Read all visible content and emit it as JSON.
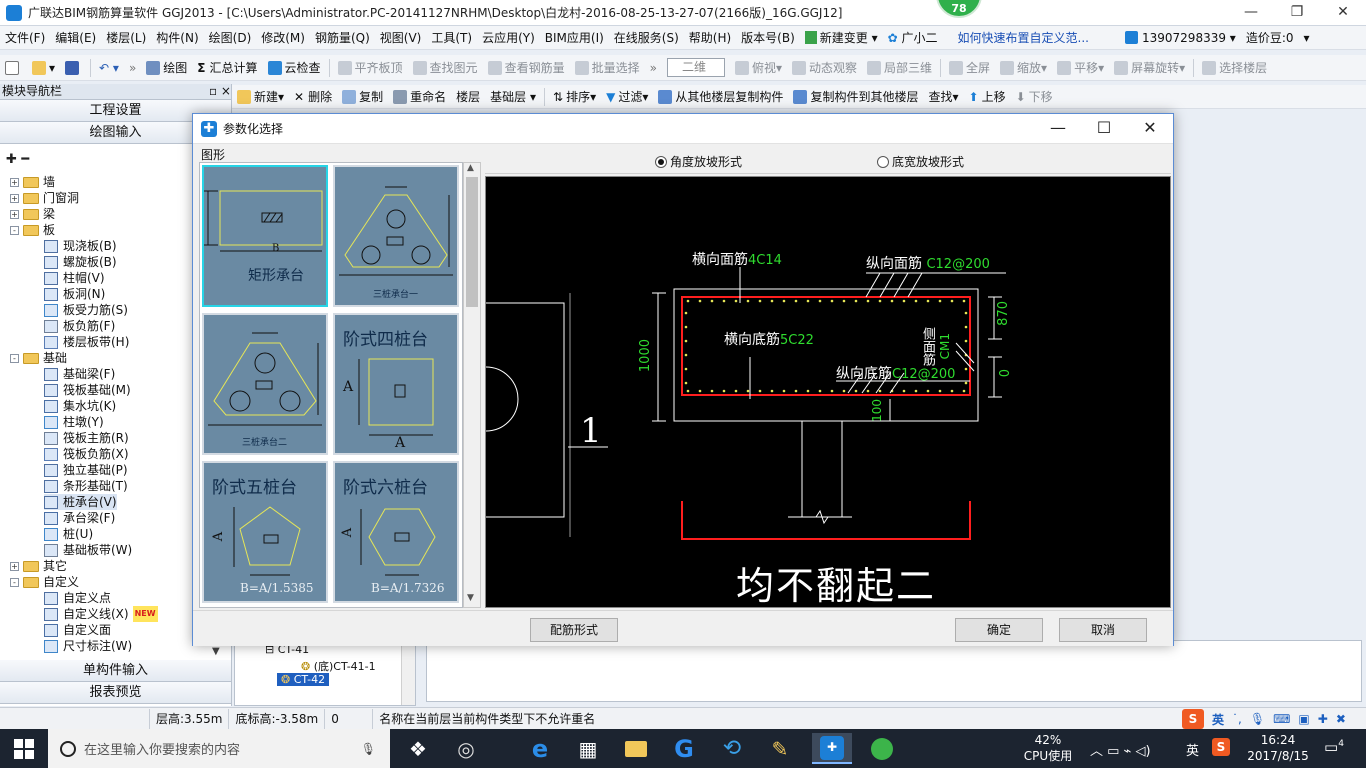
{
  "titlebar": {
    "title": "广联达BIM钢筋算量软件 GGJ2013 - [C:\\Users\\Administrator.PC-20141127NRHM\\Desktop\\白龙村-2016-08-25-13-27-07(2166版)_16G.GGJ12]",
    "badge": "78"
  },
  "menu": [
    "文件(F)",
    "编辑(E)",
    "楼层(L)",
    "构件(N)",
    "绘图(D)",
    "修改(M)",
    "钢筋量(Q)",
    "视图(V)",
    "工具(T)",
    "云应用(Y)",
    "BIM应用(I)",
    "在线服务(S)",
    "帮助(H)",
    "版本号(B)",
    "新建变更",
    "广小二",
    "如何快速布置自定义范...",
    "13907298339",
    "造价豆:0"
  ],
  "toolbar1": {
    "draw": "绘图",
    "sum": "汇总计算",
    "cloudcheck": "云检查",
    "flatten": "平齐板顶",
    "findelem": "查找图元",
    "viewrebar": "查看钢筋量",
    "batchsel": "批量选择",
    "view_mode": "二维",
    "topview": "俯视",
    "dynobserve": "动态观察",
    "local3d": "局部三维",
    "fullscreen": "全屏",
    "zoom": "缩放",
    "pan": "平移",
    "rotate": "屏幕旋转",
    "selfloor": "选择楼层"
  },
  "toolbar2": {
    "new": "新建",
    "delete": "删除",
    "copy": "复制",
    "rename": "重命名",
    "floor_label": "楼层",
    "floor_value": "基础层",
    "sort": "排序",
    "filter": "过滤",
    "copy_from": "从其他楼层复制构件",
    "copy_to": "复制构件到其他楼层",
    "find": "查找",
    "moveup": "上移",
    "movedown": "下移"
  },
  "leftpanel": {
    "header": "模块导航栏",
    "pin": "▫ ×",
    "btn_project": "工程设置",
    "btn_draw": "绘图输入",
    "btn_single": "单构件输入",
    "btn_report": "报表预览",
    "tree": [
      {
        "label": "墙",
        "level": 0,
        "toggle": "+",
        "folder": true
      },
      {
        "label": "门窗洞",
        "level": 0,
        "toggle": "+",
        "folder": true
      },
      {
        "label": "梁",
        "level": 0,
        "toggle": "+",
        "folder": true
      },
      {
        "label": "板",
        "level": 0,
        "toggle": "-",
        "folder": true
      },
      {
        "label": "现浇板(B)",
        "level": 1
      },
      {
        "label": "螺旋板(B)",
        "level": 1
      },
      {
        "label": "柱帽(V)",
        "level": 1
      },
      {
        "label": "板洞(N)",
        "level": 1
      },
      {
        "label": "板受力筋(S)",
        "level": 1
      },
      {
        "label": "板负筋(F)",
        "level": 1
      },
      {
        "label": "楼层板带(H)",
        "level": 1
      },
      {
        "label": "基础",
        "level": 0,
        "toggle": "-",
        "folder": true
      },
      {
        "label": "基础梁(F)",
        "level": 1
      },
      {
        "label": "筏板基础(M)",
        "level": 1
      },
      {
        "label": "集水坑(K)",
        "level": 1
      },
      {
        "label": "柱墩(Y)",
        "level": 1
      },
      {
        "label": "筏板主筋(R)",
        "level": 1
      },
      {
        "label": "筏板负筋(X)",
        "level": 1
      },
      {
        "label": "独立基础(P)",
        "level": 1
      },
      {
        "label": "条形基础(T)",
        "level": 1
      },
      {
        "label": "桩承台(V)",
        "level": 1,
        "selected": true
      },
      {
        "label": "承台梁(F)",
        "level": 1
      },
      {
        "label": "桩(U)",
        "level": 1
      },
      {
        "label": "基础板带(W)",
        "level": 1
      },
      {
        "label": "其它",
        "level": 0,
        "toggle": "+",
        "folder": true
      },
      {
        "label": "自定义",
        "level": 0,
        "toggle": "-",
        "folder": true
      },
      {
        "label": "自定义点",
        "level": 1
      },
      {
        "label": "自定义线(X)",
        "level": 1,
        "new": "NEW"
      },
      {
        "label": "自定义面",
        "level": 1
      },
      {
        "label": "尺寸标注(W)",
        "level": 1
      }
    ]
  },
  "midpanel": {
    "items": [
      "CT-41",
      "(底)CT-41-1",
      "CT-42"
    ]
  },
  "statusbar": {
    "floor_height": "层高:3.55m",
    "bottom_elev": "底标高:-3.58m",
    "zero": "0",
    "message": "名称在当前层当前构件类型下不允许重名"
  },
  "dialog": {
    "title": "参数化选择",
    "shape_label": "图形",
    "radio_angle": "角度放坡形式",
    "radio_width": "底宽放坡形式",
    "tiles": [
      {
        "name": "矩形承台",
        "sub": "B"
      },
      {
        "name": "三桩承台一"
      },
      {
        "name": "三桩承台二"
      },
      {
        "name": "阶式四桩台",
        "a1": "A",
        "a2": "A"
      },
      {
        "name": "阶式五桩台",
        "a": "A",
        "formula": "B=A/1.5385"
      },
      {
        "name": "阶式六桩台",
        "a": "A",
        "formula": "B=A/1.7326"
      }
    ],
    "canvas": {
      "top_trans": "横向面筋",
      "top_trans_val": "4C14",
      "top_long": "纵向面筋",
      "top_long_val": "C12@200",
      "bot_trans": "横向底筋",
      "bot_trans_val": "5C22",
      "bot_long": "纵向底筋",
      "bot_long_val": "C12@200",
      "side": "侧面筋",
      "side_val": "CM1",
      "dim_height": "1000",
      "dim_870": "870",
      "dim_0": "0",
      "dim_100": "100",
      "mark_1": "1",
      "caption": "均不翻起二"
    },
    "btn_config": "配筋形式",
    "btn_ok": "确定",
    "btn_cancel": "取消"
  },
  "taskbar": {
    "search_placeholder": "在这里输入你要搜索的内容",
    "cpu_pct": "42%",
    "cpu_label": "CPU使用",
    "ime": "英",
    "time": "16:24",
    "date": "2017/8/15",
    "notif": "4"
  },
  "colors": {
    "accent": "#1c7fd6",
    "tile_bg": "#6a8aa3",
    "cad_bg": "#000000",
    "rebar_red": "#ff1e1e",
    "cad_green": "#2fdc2f",
    "tile_shape_yellow": "#e6e657"
  }
}
